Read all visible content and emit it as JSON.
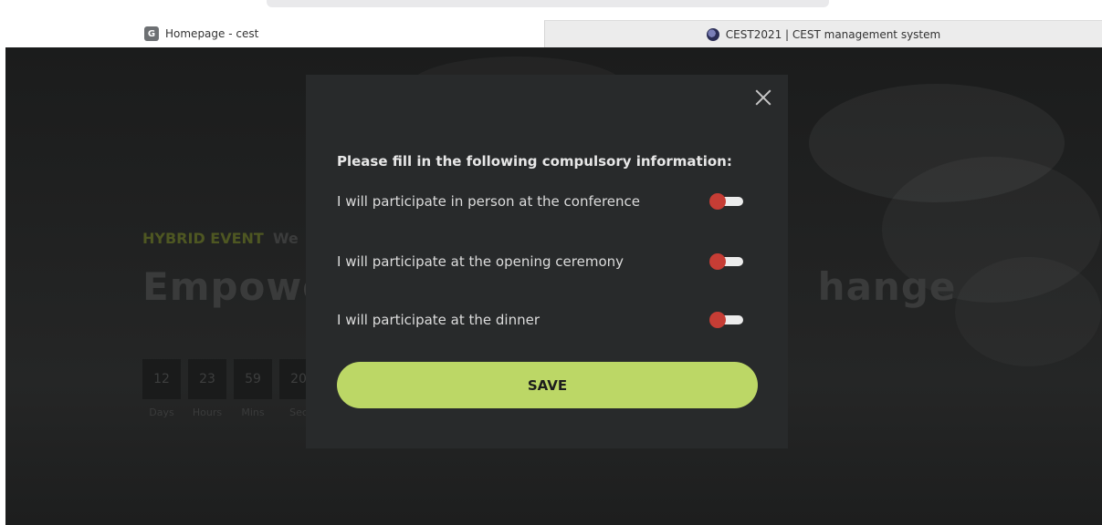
{
  "browser": {
    "tabs": [
      {
        "favicon": "G",
        "label": "Homepage - cest",
        "active": true
      },
      {
        "favicon": "globe-icon",
        "label": "CEST2021 | CEST management system",
        "active": false
      }
    ]
  },
  "hero": {
    "eyebrow_accent": "HYBRID EVENT",
    "eyebrow_rest": "We",
    "title_left": "Empowe",
    "title_right": "hange",
    "countdown": [
      {
        "value": "12",
        "label": "Days"
      },
      {
        "value": "23",
        "label": "Hours"
      },
      {
        "value": "59",
        "label": "Mins"
      },
      {
        "value": "20",
        "label": "Sec"
      }
    ]
  },
  "modal": {
    "heading": "Please fill in the following compulsory information:",
    "options": [
      {
        "label": "I will participate in person at the conference",
        "enabled": false
      },
      {
        "label": "I will participate at the opening ceremony",
        "enabled": false
      },
      {
        "label": "I will participate at the dinner",
        "enabled": false
      }
    ],
    "save_label": "SAVE",
    "close_icon": "close-icon"
  },
  "colors": {
    "accent": "#bcd766",
    "toggle_off_knob": "#c63d35",
    "modal_bg": "#282a2b"
  }
}
